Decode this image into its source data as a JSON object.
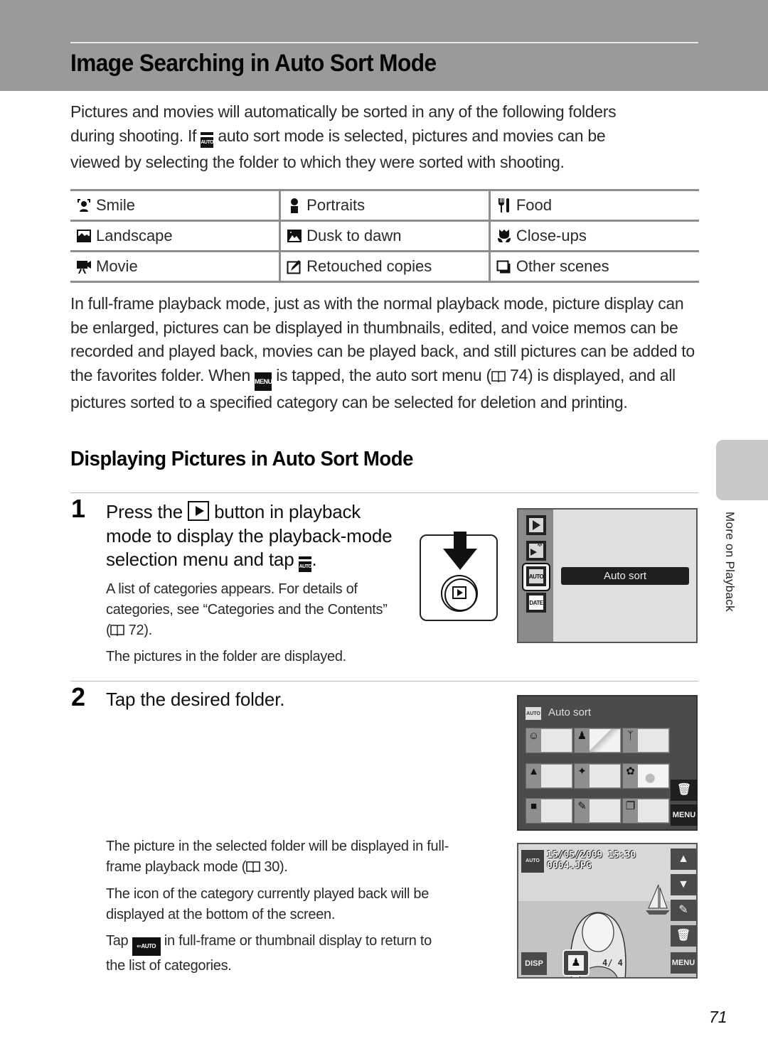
{
  "page": {
    "title": "Image Searching in Auto Sort Mode",
    "page_number": "71",
    "side_tab_label": "More on Playback"
  },
  "intro": {
    "line1": "Pictures and movies will automatically be sorted in any of the following folders",
    "line2_before_icon": "during shooting. If ",
    "line2_icon": "auto-sort-icon",
    "line2_after_icon": " auto sort mode is selected, pictures and movies can be",
    "line3": "viewed by selecting the folder to which they were sorted with shooting."
  },
  "categories": [
    {
      "icon": "smile-icon",
      "glyph": "☺",
      "label": "Smile"
    },
    {
      "icon": "portraits-icon",
      "glyph": "♟",
      "label": "Portraits"
    },
    {
      "icon": "food-icon",
      "glyph": "🍴",
      "label": "Food"
    },
    {
      "icon": "landscape-icon",
      "glyph": "▲",
      "label": "Landscape"
    },
    {
      "icon": "dusk-to-dawn-icon",
      "glyph": "✦",
      "label": "Dusk to dawn"
    },
    {
      "icon": "close-ups-icon",
      "glyph": "✿",
      "label": "Close-ups"
    },
    {
      "icon": "movie-icon",
      "glyph": "■",
      "label": "Movie"
    },
    {
      "icon": "retouched-copies-icon",
      "glyph": "✎",
      "label": "Retouched copies"
    },
    {
      "icon": "other-scenes-icon",
      "glyph": "❐",
      "label": "Other scenes"
    }
  ],
  "para2": {
    "part1": "In full-frame playback mode, just as with the normal playback mode, picture display can be enlarged, pictures can be displayed in thumbnails, edited, and voice memos can be recorded and played back, movies can be played back, and still pictures can be added to the favorites folder. When ",
    "menu_icon_text": "MENU",
    "part2": " is tapped, the auto sort menu (",
    "ref_page": "74",
    "part3": ") is displayed, and all pictures sorted to a specified category can be selected for deletion and printing."
  },
  "section": {
    "title": "Displaying Pictures in Auto Sort Mode"
  },
  "steps": [
    {
      "number": "1",
      "heading_part1": "Press the ",
      "heading_part2": " button in playback",
      "heading_line2": "mode to display the playback-mode",
      "heading_line3_before": "selection menu and tap ",
      "heading_line3_after": ".",
      "note1_line1": "A list of categories appears. For details of",
      "note1_line2": "categories, see “Categories and the Contents”",
      "note1_ref_page": "72",
      "note2": "The pictures in the folder are displayed."
    },
    {
      "number": "2",
      "heading": "Tap the desired folder.",
      "note1_line1": "The picture in the selected folder will be displayed in full-",
      "note1_line2_before": "frame playback mode (",
      "note1_ref_page": "30",
      "note1_line2_after": ").",
      "note2_line1": "The icon of the category currently played back will be",
      "note2_line2": "displayed at the bottom of the screen.",
      "note3_before": "Tap ",
      "note3_after": " in full-frame or thumbnail display to return to",
      "note3_line2": "the list of categories."
    }
  ],
  "screen_playback_menu": {
    "selected_label": "Auto sort",
    "icons": [
      "playback-icon",
      "favorites-icon",
      "auto-sort-icon",
      "list-by-date-icon"
    ],
    "date_text": "DATE",
    "auto_text": "AUTO"
  },
  "screen_auto_sort": {
    "title": "Auto sort",
    "auto_text": "AUTO",
    "menu_label": "MENU",
    "delete_glyph": "🗑",
    "cells": [
      {
        "icon": "smile-icon",
        "glyph": "☺"
      },
      {
        "icon": "portraits-icon",
        "glyph": "♟"
      },
      {
        "icon": "food-icon",
        "glyph": "ᛉ"
      },
      {
        "icon": "landscape-icon",
        "glyph": "▲"
      },
      {
        "icon": "dusk-to-dawn-icon",
        "glyph": "✦"
      },
      {
        "icon": "close-ups-icon",
        "glyph": "✿"
      },
      {
        "icon": "movie-icon",
        "glyph": "■"
      },
      {
        "icon": "retouched-copies-icon",
        "glyph": "✎"
      },
      {
        "icon": "other-scenes-icon",
        "glyph": "❐"
      }
    ]
  },
  "screen_full_frame": {
    "datetime": "15/05/2009 15:30",
    "filename": "0004.JPG",
    "disp_label": "DISP",
    "menu_label": "MENU",
    "up_glyph": "▲",
    "down_glyph": "▼",
    "retouch_glyph": "✎",
    "delete_glyph": "🗑",
    "counter": "4/   4",
    "back_text": "AUTO",
    "category_glyph": "♟"
  }
}
